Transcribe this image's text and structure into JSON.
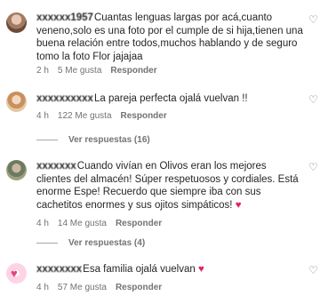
{
  "comments": [
    {
      "username": "xxxxxx1957",
      "text": "Cuantas lenguas largas por acá,cuanto veneno,solo es una foto por el cumple de si hija,tienen una buena relación entre todos,muchos hablando y de seguro tomo la foto Flor jajajaa",
      "time": "2 h",
      "likes": "5 Me gusta",
      "reply": "Responder",
      "view_replies": ""
    },
    {
      "username": "xxxxxxxxxx",
      "text": "La pareja perfecta ojalá vuelvan !!",
      "time": "4 h",
      "likes": "122 Me gusta",
      "reply": "Responder",
      "view_replies": "Ver respuestas (16)"
    },
    {
      "username": "xxxxxxx",
      "text": "Cuando vivían en Olivos eran los mejores clientes del almacén! Súper respetuosos y cordiales. Está enorme Espe! Recuerdo que siempre iba con sus cachetitos enormes y sus ojitos simpáticos!",
      "time": "4 h",
      "likes": "14 Me gusta",
      "reply": "Responder",
      "view_replies": "Ver respuestas (4)"
    },
    {
      "username": "xxxxxxxx",
      "text": "Esa familia ojalá vuelvan",
      "time": "4 h",
      "likes": "57 Me gusta",
      "reply": "Responder",
      "view_replies": ""
    }
  ],
  "icons": {
    "like": "heart-outline-icon",
    "emoji_heart": "red-heart-emoji"
  },
  "colors": {
    "meta_text": "#737373",
    "heart_emoji": "#e0245e"
  }
}
